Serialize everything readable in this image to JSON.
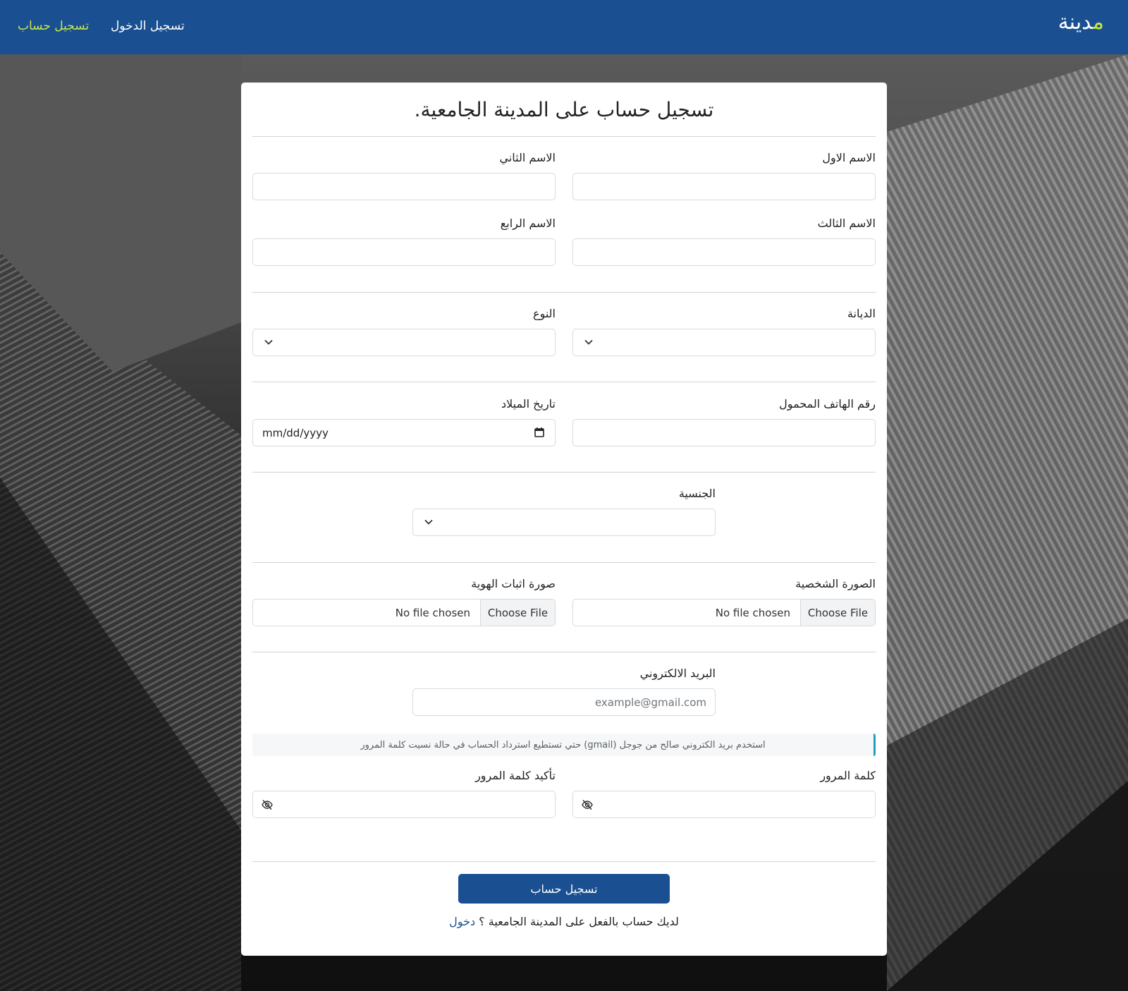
{
  "navbar": {
    "brand_accent": "م",
    "brand_rest": "دينة",
    "login": "تسجيل الدخول",
    "register": "تسجيل حساب"
  },
  "card": {
    "title": "تسجيل حساب على المدينة الجامعية."
  },
  "fields": {
    "first_name": "الاسم الاول",
    "second_name": "الاسم الثاني",
    "third_name": "الاسم الثالث",
    "fourth_name": "الاسم الرابع",
    "religion": "الديانة",
    "gender": "النوع",
    "mobile": "رقم الهاتف المحمول",
    "birthdate": "تاريخ الميلاد",
    "birthdate_placeholder": "mm/dd/yyyy",
    "nationality": "الجنسية",
    "photo": "الصورة الشخصية",
    "id_photo": "صورة اثبات الهوية",
    "file_button": "Choose File",
    "file_none": "No file chosen",
    "email": "البريد الالكتروني",
    "email_placeholder": "example@gmail.com",
    "password": "كلمة المرور",
    "confirm_password": "تأكيد كلمة المرور"
  },
  "alert": "استخدم بريد الكتروني صالح من جوجل (gmail) حتي تستطيع استرداد الحساب في حالة نسيت كلمة المرور",
  "submit": "تسجيل حساب",
  "footer": {
    "question": "لديك حساب بالفعل على المدينة الجامعية ؟",
    "login_link": "دخول"
  },
  "colors": {
    "primary": "#1a5091",
    "accent": "#c7e94a",
    "info": "#1fa2b8"
  },
  "icons": [
    "chevron-down-icon",
    "calendar-icon",
    "eye-slash-icon"
  ]
}
